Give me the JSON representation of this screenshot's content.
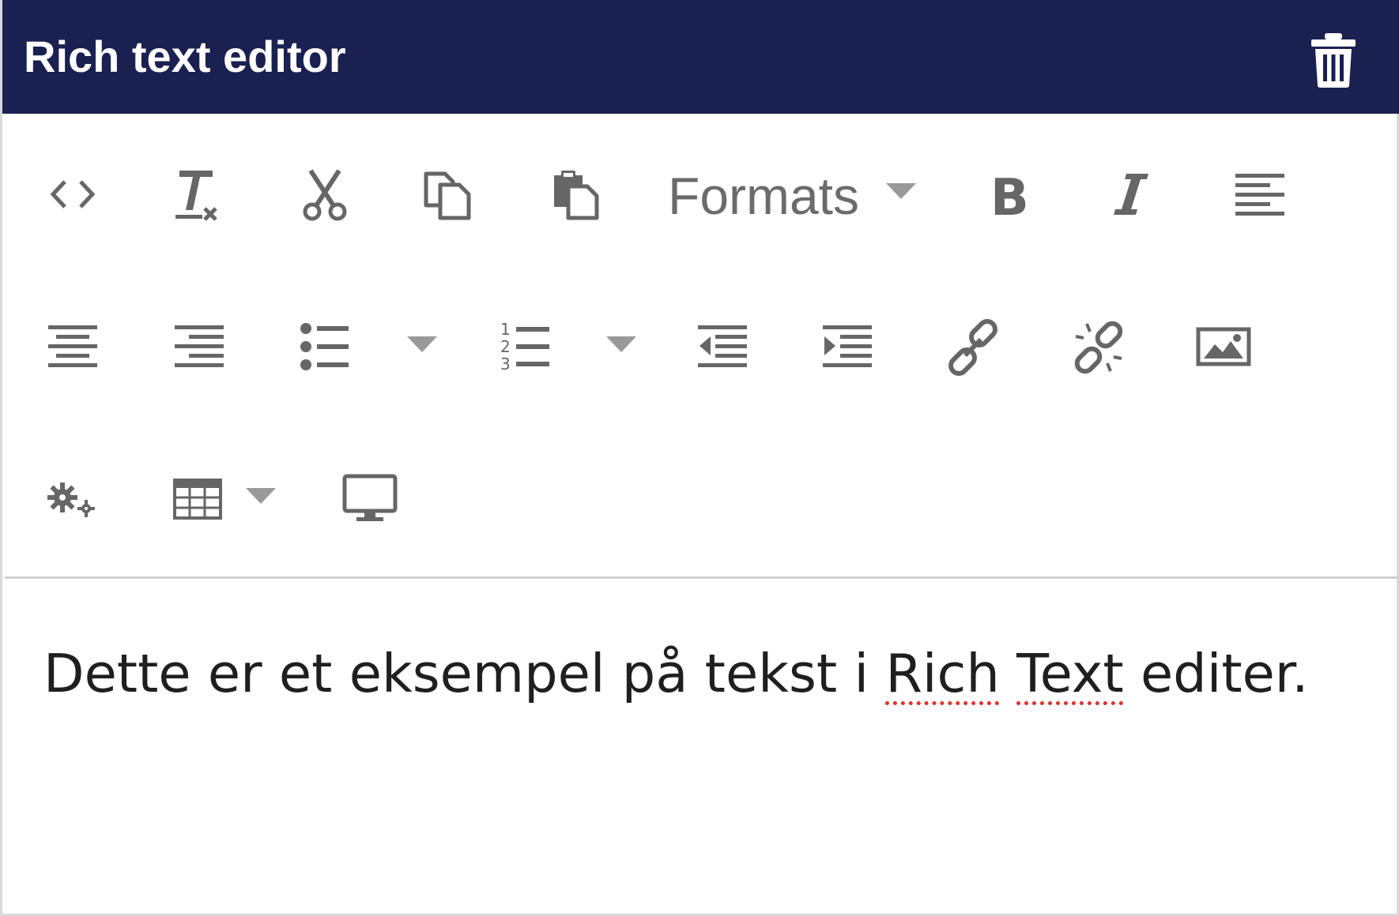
{
  "header": {
    "title": "Rich text editor",
    "delete_icon": "trash-icon"
  },
  "toolbar": {
    "row1": [
      "source-code-icon",
      "clear-formatting-icon",
      "cut-icon",
      "copy-icon",
      "paste-icon",
      "formats-dropdown",
      "bold-icon",
      "italic-icon",
      "align-left-icon"
    ],
    "row2": [
      "align-center-icon",
      "align-right-icon",
      "bullet-list-icon",
      "bullet-list-options",
      "numbered-list-icon",
      "numbered-list-options",
      "outdent-icon",
      "indent-icon",
      "link-icon",
      "unlink-icon",
      "image-icon"
    ],
    "row3": [
      "macro-settings-icon",
      "table-icon",
      "table-options",
      "embed-monitor-icon"
    ],
    "formats_label": "Formats"
  },
  "editor": {
    "text_before": "Dette er et eksempel på tekst i ",
    "misspelled_1": "Rich",
    "space": " ",
    "misspelled_2": "Text",
    "text_after": " editer."
  },
  "colors": {
    "header_bg": "#1a2151",
    "header_text": "#ffffff",
    "icon": "#666666",
    "spellcheck": "#e0322b"
  }
}
